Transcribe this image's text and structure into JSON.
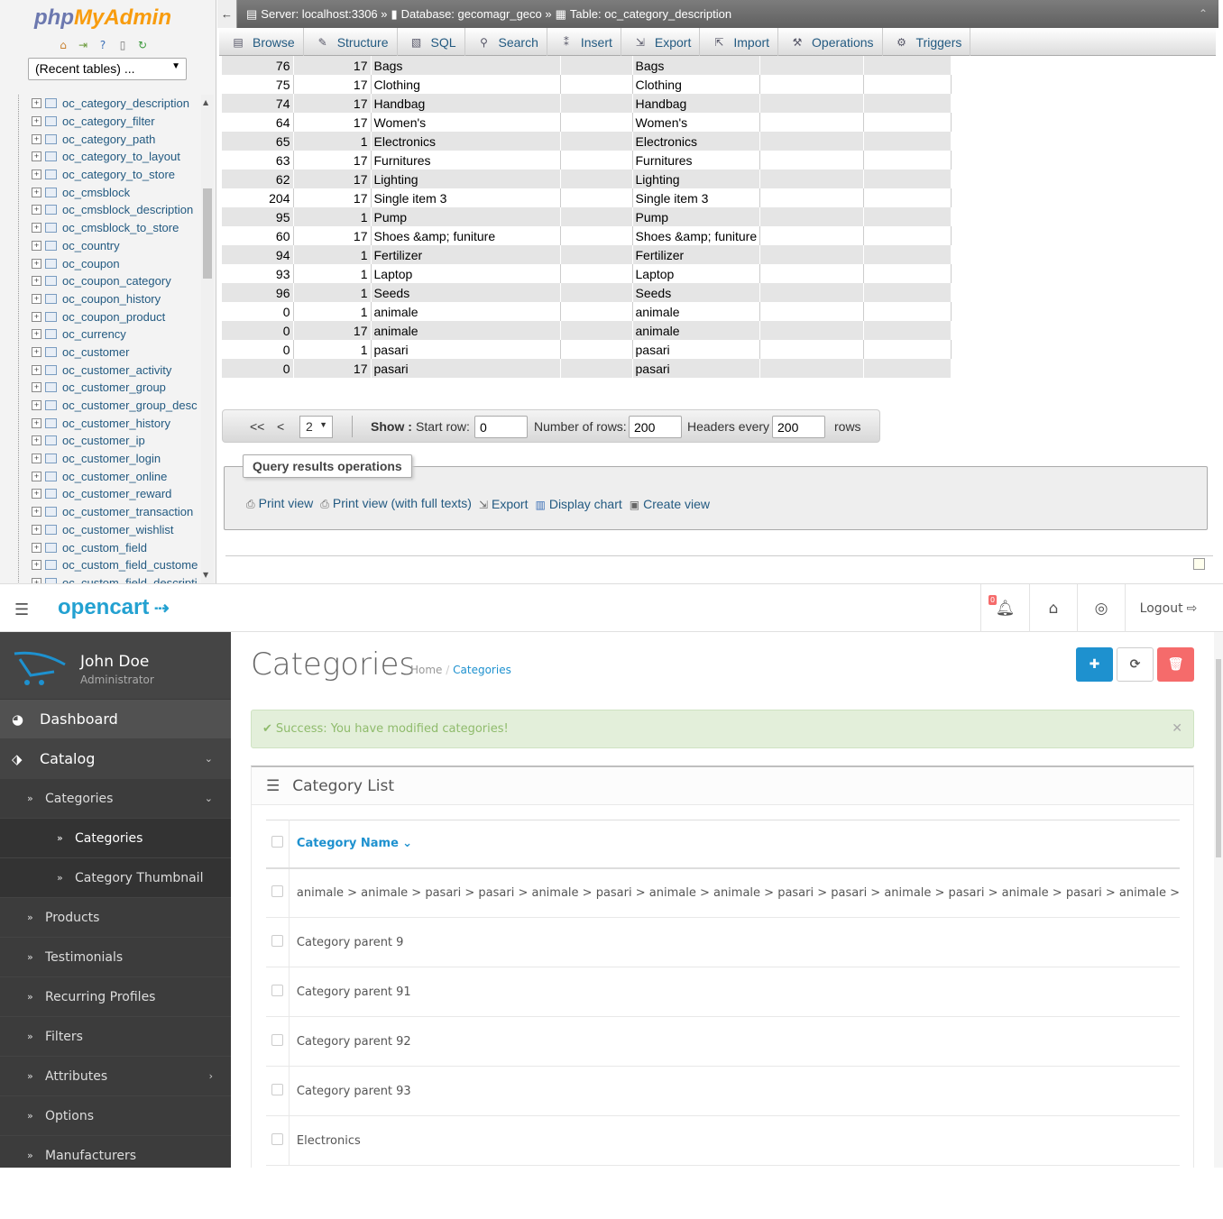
{
  "pma": {
    "logo_php": "php",
    "logo_myadmin": "MyAdmin",
    "recent_tables": "(Recent tables) ...",
    "tree_items": [
      "oc_category_description",
      "oc_category_filter",
      "oc_category_path",
      "oc_category_to_layout",
      "oc_category_to_store",
      "oc_cmsblock",
      "oc_cmsblock_description",
      "oc_cmsblock_to_store",
      "oc_country",
      "oc_coupon",
      "oc_coupon_category",
      "oc_coupon_history",
      "oc_coupon_product",
      "oc_currency",
      "oc_customer",
      "oc_customer_activity",
      "oc_customer_group",
      "oc_customer_group_desc",
      "oc_customer_history",
      "oc_customer_ip",
      "oc_customer_login",
      "oc_customer_online",
      "oc_customer_reward",
      "oc_customer_transaction",
      "oc_customer_wishlist",
      "oc_custom_field",
      "oc_custom_field_custome",
      "oc_custom_field_descripti"
    ],
    "breadcrumb": {
      "server": "Server: localhost:3306 »",
      "database": "Database: gecomagr_geco »",
      "table": "Table: oc_category_description"
    },
    "tabs": [
      "Browse",
      "Structure",
      "SQL",
      "Search",
      "Insert",
      "Export",
      "Import",
      "Operations",
      "Triggers"
    ],
    "rows": [
      [
        "76",
        "17",
        "Bags",
        "",
        "Bags",
        "",
        ""
      ],
      [
        "75",
        "17",
        "Clothing",
        "",
        "Clothing",
        "",
        ""
      ],
      [
        "74",
        "17",
        "Handbag",
        "",
        "Handbag",
        "",
        ""
      ],
      [
        "64",
        "17",
        "Women's",
        "",
        "Women's",
        "",
        ""
      ],
      [
        "65",
        "1",
        "Electronics",
        "",
        "Electronics",
        "",
        ""
      ],
      [
        "63",
        "17",
        "Furnitures",
        "",
        "Furnitures",
        "",
        ""
      ],
      [
        "62",
        "17",
        "Lighting",
        "",
        "Lighting",
        "",
        ""
      ],
      [
        "204",
        "17",
        "Single item 3",
        "",
        "Single item 3",
        "",
        ""
      ],
      [
        "95",
        "1",
        "Pump",
        "",
        "Pump",
        "",
        ""
      ],
      [
        "60",
        "17",
        "Shoes &amp; funiture",
        "",
        "Shoes &amp; funiture",
        "",
        ""
      ],
      [
        "94",
        "1",
        "Fertilizer",
        "",
        "Fertilizer",
        "",
        ""
      ],
      [
        "93",
        "1",
        "Laptop",
        "",
        "Laptop",
        "",
        ""
      ],
      [
        "96",
        "1",
        "Seeds",
        "",
        "Seeds",
        "",
        ""
      ],
      [
        "0",
        "1",
        "animale",
        "",
        "animale",
        "",
        ""
      ],
      [
        "0",
        "17",
        "animale",
        "",
        "animale",
        "",
        ""
      ],
      [
        "0",
        "1",
        "pasari",
        "",
        "pasari",
        "",
        ""
      ],
      [
        "0",
        "17",
        "pasari",
        "",
        "pasari",
        "",
        ""
      ]
    ],
    "nav": {
      "first": "<<",
      "prev": "<",
      "page": "2",
      "show": "Show :",
      "start_row_label": "Start row:",
      "start_row": "0",
      "num_rows_label": "Number of rows:",
      "num_rows": "200",
      "headers_label": "Headers every",
      "headers": "200",
      "rows_label": "rows"
    },
    "qro": {
      "legend": "Query results operations",
      "links": [
        "Print view",
        "Print view (with full texts)",
        "Export",
        "Display chart",
        "Create view"
      ]
    }
  },
  "oc": {
    "logo": "opencart",
    "badge": "0",
    "logout": "Logout",
    "user": {
      "name": "John Doe",
      "role": "Administrator"
    },
    "menu": {
      "dashboard": "Dashboard",
      "catalog": "Catalog",
      "categories": "Categories",
      "categories_sub": "Categories",
      "thumbnail": "Category Thumbnail",
      "products": "Products",
      "testimonials": "Testimonials",
      "recurring": "Recurring Profiles",
      "filters": "Filters",
      "attributes": "Attributes",
      "options": "Options",
      "manufacturers": "Manufacturers"
    },
    "title": "Categories",
    "breadcrumb": {
      "home": "Home",
      "sep": "/",
      "current": "Categories"
    },
    "alert": "Success: You have modified categories!",
    "panel_title": "Category List",
    "column_header": "Category Name",
    "categories": [
      "animale  >  animale  >  pasari  >  pasari  >  animale  >  pasari  >  animale  >  animale  >  pasari  >  pasari  >  animale  >  pasari  >  animale  >  pasari  >  animale  >",
      "Category parent 9",
      "Category parent 91",
      "Category parent 92",
      "Category parent 93",
      "Electronics"
    ],
    "colors": {
      "primary": "#1e91cf",
      "danger": "#f56b6b",
      "sidebar": "#515151",
      "success_bg": "#e3efda"
    }
  }
}
